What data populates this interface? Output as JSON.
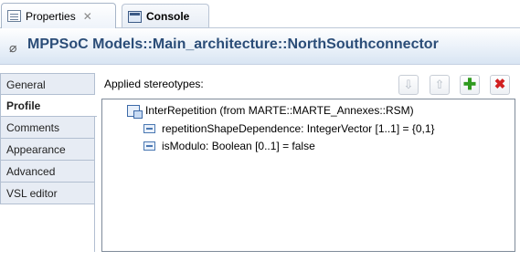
{
  "tabs": {
    "properties": {
      "label": "Properties",
      "close": "✕"
    },
    "console": {
      "label": "Console"
    }
  },
  "header": {
    "title": "MPPSoC Models::Main_architecture::NorthSouthconnector",
    "icon": "connector-icon"
  },
  "side_tabs": [
    {
      "label": "General"
    },
    {
      "label": "Profile",
      "selected": true
    },
    {
      "label": "Comments"
    },
    {
      "label": "Appearance"
    },
    {
      "label": "Advanced"
    },
    {
      "label": "VSL editor"
    }
  ],
  "main": {
    "applied_label": "Applied stereotypes:",
    "buttons": {
      "down": "⇩",
      "up": "⇧",
      "add": "✚",
      "delete": "✖"
    },
    "tree": {
      "stereotype": "InterRepetition    (from MARTE::MARTE_Annexes::RSM)",
      "properties": [
        "repetitionShapeDependence: IntegerVector [1..1] = {0,1}",
        "isModulo: Boolean [0..1] = false"
      ]
    }
  },
  "colors": {
    "title_text": "#2b4d78",
    "add_green": "#2f9a1f",
    "delete_red": "#d12020"
  }
}
